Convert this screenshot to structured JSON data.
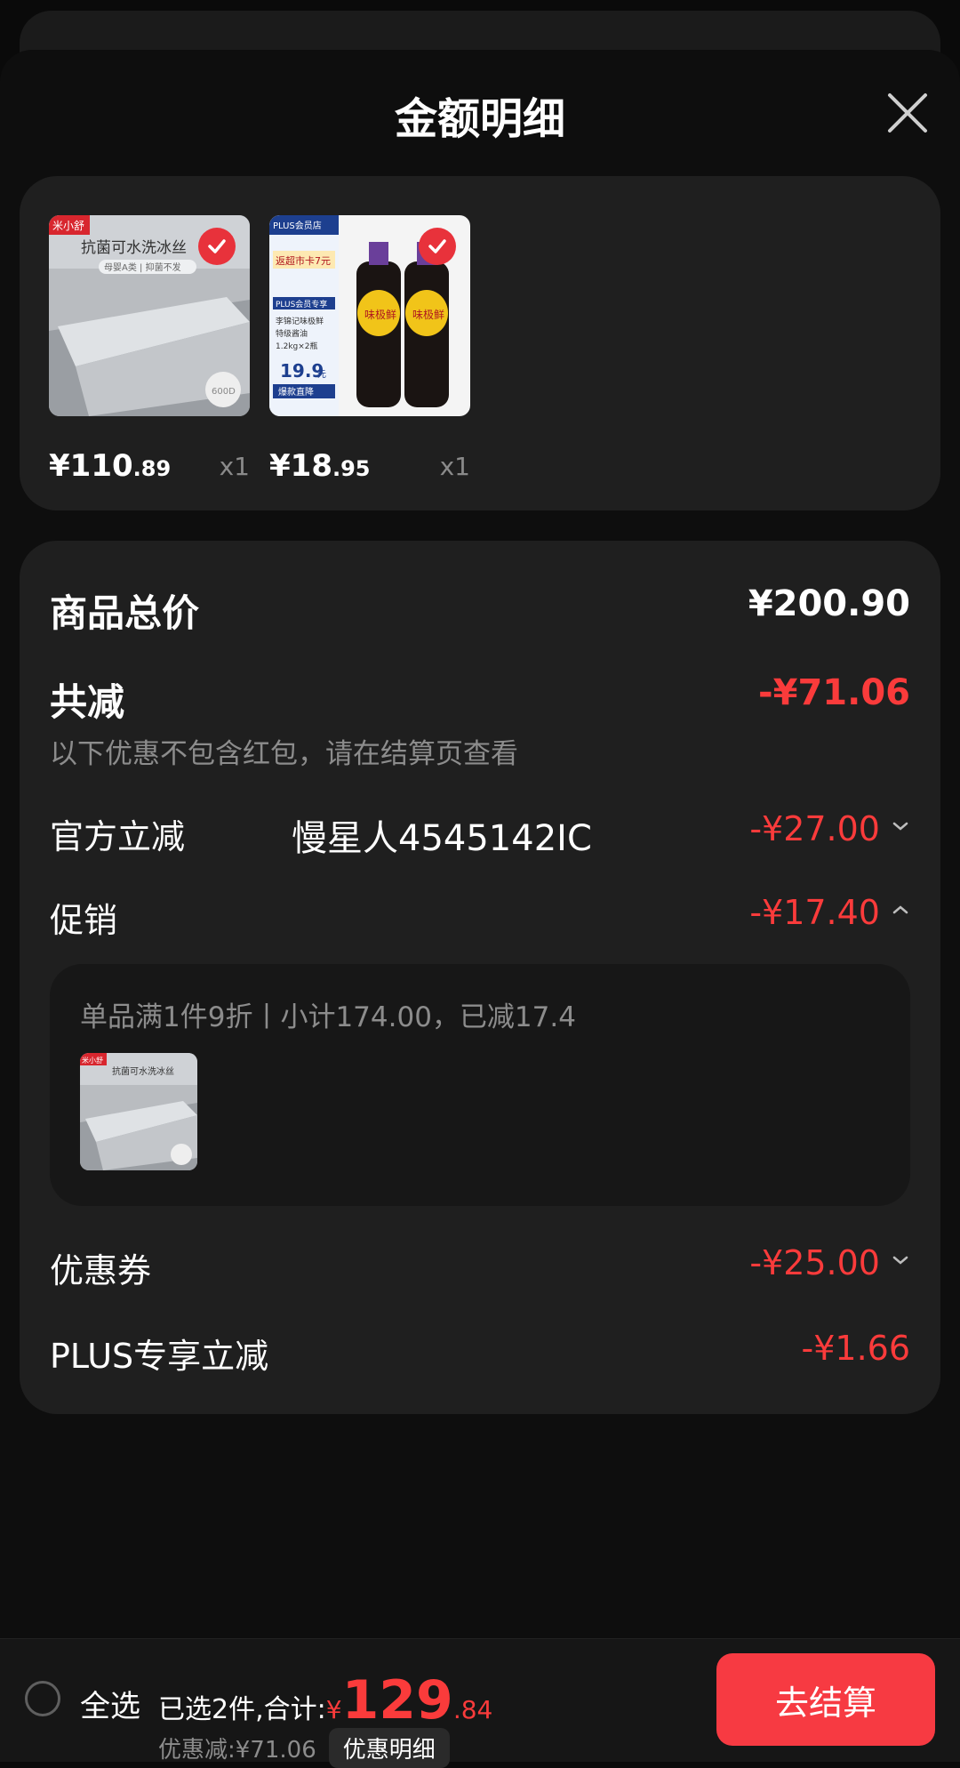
{
  "sheet": {
    "title": "金额明细"
  },
  "products": [
    {
      "name": "cooling mat",
      "price_int": "¥110",
      "price_cents": ".89",
      "qty": "x1",
      "badge": "米小舒",
      "banner": "抗菌可水洗冰丝",
      "sub_banner": "母婴A类 | 抑菌不发",
      "tag": "600D"
    },
    {
      "name": "soy sauce",
      "price_int": "¥18",
      "price_cents": ".95",
      "qty": "x1",
      "store": "PLUS会员店",
      "promo_line1": "返超市卡7元",
      "promo_line2": "PLUS会员专享",
      "promo_line3": "李锦记味极鲜",
      "promo_line4": "特级酱油",
      "promo_line5": "1.2kg×2瓶",
      "promo_price": "19.9",
      "promo_unit": "元",
      "promo_line6": "爆款直降",
      "bottle_text": "味极鲜"
    }
  ],
  "breakdown": {
    "total_label": "商品总价",
    "total_value": "¥200.90",
    "reduce_label": "共减",
    "reduce_value": "-¥71.06",
    "note": "以下优惠不包含红包，请在结算页查看",
    "official_label": "官方立减",
    "official_value": "-¥27.00",
    "overlay_text": "慢星人4545142IC",
    "promo_label": "促销",
    "promo_value": "-¥17.40",
    "promo_desc": "单品满1件9折丨小计174.00，已减17.4",
    "coupon_label": "优惠券",
    "coupon_value": "-¥25.00",
    "plus_label": "PLUS专享立减",
    "plus_value": "-¥1.66"
  },
  "bottom": {
    "select_all": "全选",
    "summary": "已选2件,合计:",
    "total_yen": "¥",
    "total_int": "129",
    "total_cents": ".84",
    "discount": "优惠减:¥71.06",
    "detail_button": "优惠明细",
    "checkout": "去结算"
  },
  "colors": {
    "accent": "#fa3b3b",
    "button": "#f73a42",
    "card": "#1f1f1f",
    "background": "#0e0e0e"
  }
}
